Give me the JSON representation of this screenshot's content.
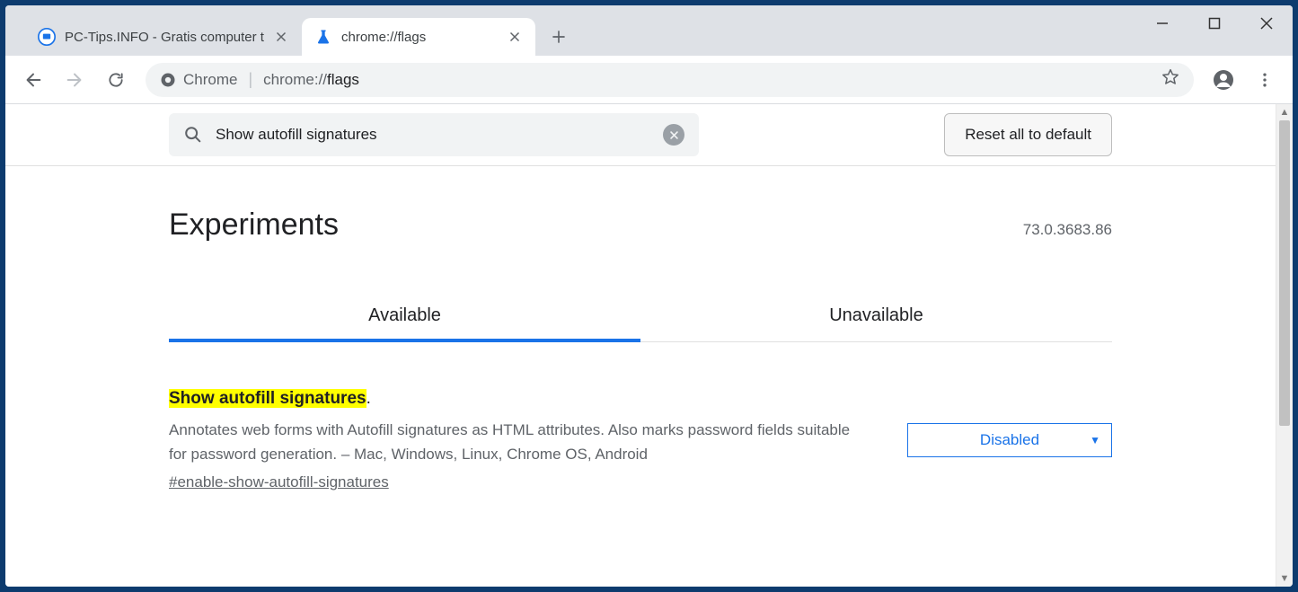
{
  "window": {
    "tabs": [
      {
        "title": "PC-Tips.INFO - Gratis computer t",
        "active": false
      },
      {
        "title": "chrome://flags",
        "active": true
      }
    ]
  },
  "omnibox": {
    "chip_label": "Chrome",
    "url_prefix": "chrome://",
    "url_path": "flags"
  },
  "flags": {
    "search_value": "Show autofill signatures",
    "reset_label": "Reset all to default",
    "experiments_title": "Experiments",
    "version": "73.0.3683.86",
    "tabs": [
      {
        "label": "Available",
        "active": true
      },
      {
        "label": "Unavailable",
        "active": false
      }
    ],
    "item": {
      "highlight": "Show autofill signatures",
      "title_suffix": ".",
      "description": "Annotates web forms with Autofill signatures as HTML attributes. Also marks password fields suitable for password generation. – Mac, Windows, Linux, Chrome OS, Android",
      "link": "#enable-show-autofill-signatures",
      "select_value": "Disabled"
    }
  }
}
